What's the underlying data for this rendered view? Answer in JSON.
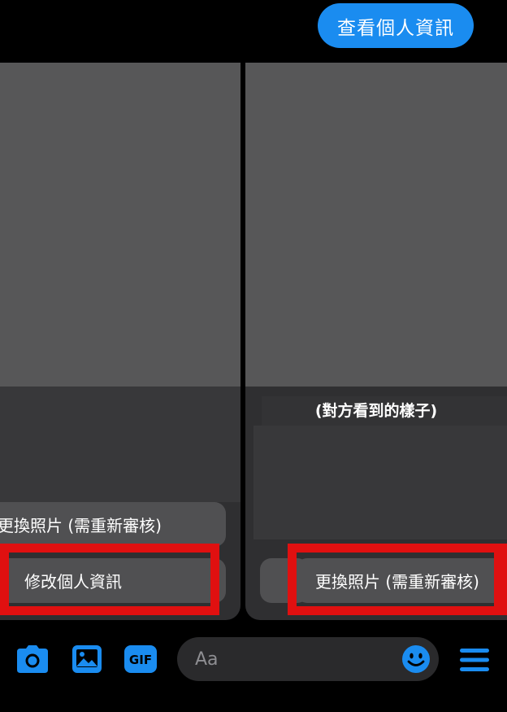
{
  "header": {
    "view_profile_label": "查看個人資訊"
  },
  "left_card": {
    "change_photo_label": "更換照片 (需重新審核)",
    "edit_profile_label": "修改個人資訊"
  },
  "right_card": {
    "caption": "(對方看到的樣子)",
    "change_photo_label": "更換照片 (需重新審核)"
  },
  "composer": {
    "placeholder": "Aa",
    "icons": [
      "camera-icon",
      "image-icon",
      "gif-icon",
      "emoji-icon",
      "menu-icon"
    ],
    "gif_label": "GIF"
  },
  "colors": {
    "accent": "#1a8cf0",
    "highlight": "#e01010",
    "background": "#000000",
    "card": "#2f2f31",
    "photo_placeholder": "#575758"
  }
}
